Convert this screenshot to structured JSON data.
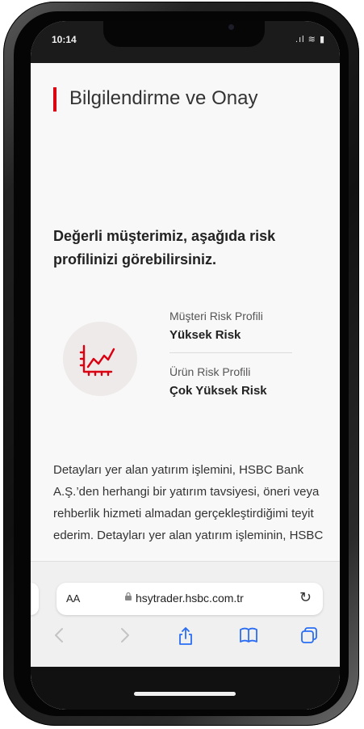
{
  "status_bar": {
    "time": "10:14",
    "signal": ".ıl",
    "wifi": "≋",
    "battery": "▮"
  },
  "page": {
    "title": "Bilgilendirme ve Onay",
    "headline": "Değerli müşterimiz, aşağıda risk profilinizi görebilirsiniz.",
    "customer_risk_label": "Müşteri Risk Profili",
    "customer_risk_value": "Yüksek Risk",
    "product_risk_label": "Ürün Risk Profili",
    "product_risk_value": "Çok Yüksek Risk",
    "body_text": "Detayları yer alan yatırım işlemini, HSBC Bank A.Ş.’den herhangi bir yatırım tavsiyesi, öneri veya rehberlik hizmeti almadan gerçekleştirdiğimi teyit ederim. Detayları yer alan yatırım işleminin, HSBC"
  },
  "safari": {
    "aa_label": "AA",
    "url": "hsytrader.hsbc.com.tr",
    "back_icon": "chevron-left-icon",
    "forward_icon": "chevron-right-icon",
    "share_icon": "share-icon",
    "bookmarks_icon": "book-icon",
    "tabs_icon": "tabs-icon"
  },
  "colors": {
    "accent": "#db0011",
    "link": "#2a6df4"
  }
}
